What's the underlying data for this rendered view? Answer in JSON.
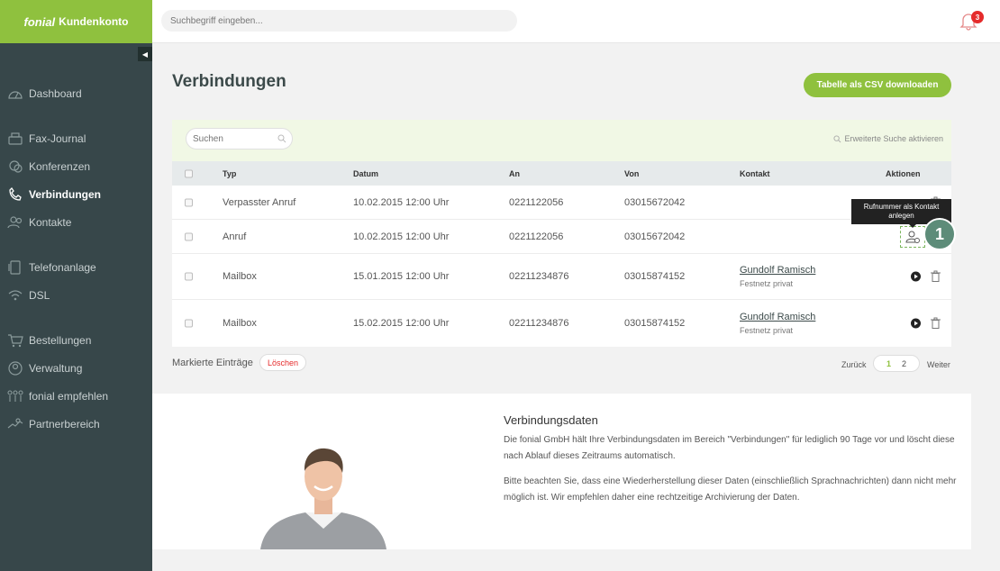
{
  "brand": {
    "logo": "fonial",
    "title": "Kundenkonto",
    "accent": "#8fc13e"
  },
  "topbar": {
    "search_placeholder": "Suchbegriff eingeben...",
    "notification_count": "3"
  },
  "sidebar": {
    "items": [
      {
        "label": "Dashboard",
        "icon": "dashboard-icon"
      },
      {
        "label": "Fax-Journal",
        "icon": "fax-icon"
      },
      {
        "label": "Konferenzen",
        "icon": "conference-icon"
      },
      {
        "label": "Verbindungen",
        "icon": "phone-icon",
        "active": true
      },
      {
        "label": "Kontakte",
        "icon": "contacts-icon"
      },
      {
        "label": "Telefonanlage",
        "icon": "pbx-icon"
      },
      {
        "label": "DSL",
        "icon": "wifi-icon"
      },
      {
        "label": "Bestellungen",
        "icon": "cart-icon"
      },
      {
        "label": "Verwaltung",
        "icon": "admin-icon"
      },
      {
        "label": "fonial empfehlen",
        "icon": "recommend-icon"
      },
      {
        "label": "Partnerbereich",
        "icon": "partner-icon"
      }
    ]
  },
  "main": {
    "title": "Verbindungen",
    "csv_button": "Tabelle als CSV downloaden",
    "table_search_placeholder": "Suchen",
    "advanced_search": "Erweiterte Suche aktivieren",
    "columns": {
      "typ": "Typ",
      "datum": "Datum",
      "an": "An",
      "von": "Von",
      "kontakt": "Kontakt",
      "aktionen": "Aktionen"
    },
    "rows": [
      {
        "typ": "Verpasster Anruf",
        "datum": "10.02.2015 12:00 Uhr",
        "an": "0221122056",
        "von": "03015672042",
        "kontakt": "",
        "kontakt_sub": ""
      },
      {
        "typ": "Anruf",
        "datum": "10.02.2015 12:00 Uhr",
        "an": "0221122056",
        "von": "03015672042",
        "kontakt": "",
        "kontakt_sub": ""
      },
      {
        "typ": "Mailbox",
        "datum": "15.01.2015 12:00 Uhr",
        "an": "02211234876",
        "von": "03015874152",
        "kontakt": "Gundolf Ramisch",
        "kontakt_sub": "Festnetz privat"
      },
      {
        "typ": "Mailbox",
        "datum": "15.02.2015 12:00 Uhr",
        "an": "02211234876",
        "von": "03015874152",
        "kontakt": "Gundolf Ramisch",
        "kontakt_sub": "Festnetz privat"
      }
    ],
    "tooltip": "Rufnummer als Kontakt anlegen",
    "step_number": "1",
    "marked_entries": "Markierte Einträge",
    "delete_button": "Löschen",
    "pager": {
      "back": "Zurück",
      "pages": [
        "1",
        "2"
      ],
      "next": "Weiter"
    }
  },
  "info": {
    "title": "Verbindungsdaten",
    "paragraph1": "Die fonial GmbH hält Ihre Verbindungsdaten im Bereich \"Verbindungen\" für lediglich 90 Tage vor und löscht diese nach Ablauf dieses Zeitraums automatisch.",
    "paragraph2": "Bitte beachten Sie, dass eine Wiederherstellung dieser Daten (einschließlich Sprachnachrichten) dann nicht mehr möglich ist. Wir empfehlen daher eine rechtzeitige Archivierung der Daten."
  }
}
